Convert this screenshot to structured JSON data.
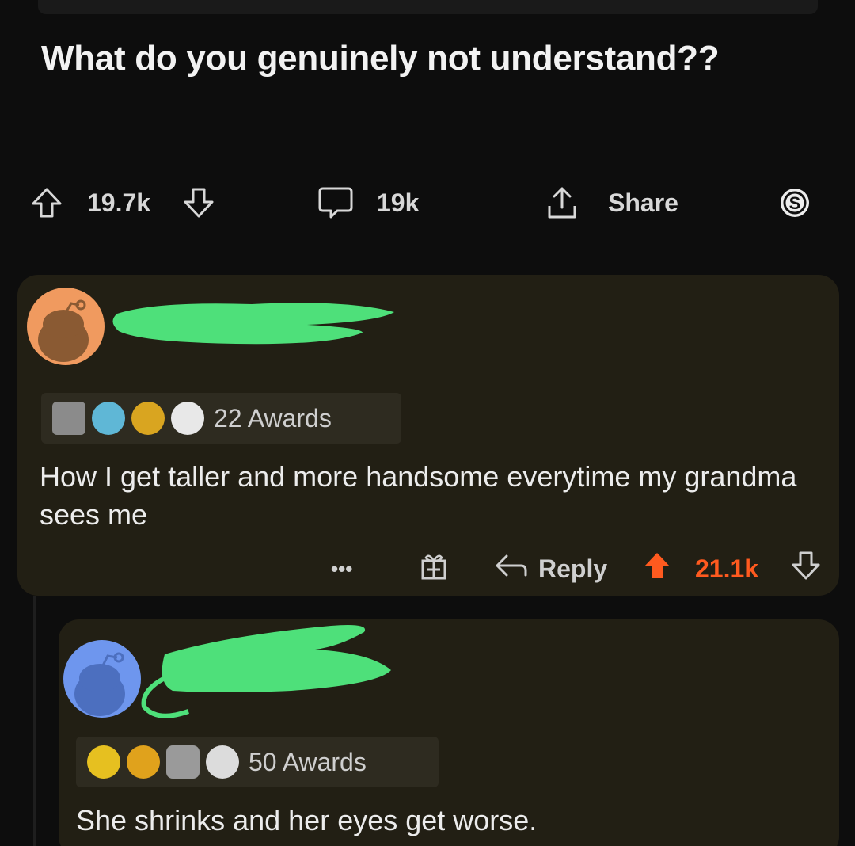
{
  "post": {
    "title": "What do you genuinely not understand??",
    "upvotes": "19.7k",
    "comments": "19k",
    "share_label": "Share"
  },
  "comments": [
    {
      "avatar_color": "#f09a5f",
      "awards_label": "22 Awards",
      "text": "How I get taller and more handsome everytime my grandma sees me",
      "more_label": "•••",
      "reply_label": "Reply",
      "score": "21.1k",
      "score_color": "#ff5a1f"
    },
    {
      "avatar_color": "#6e96ee",
      "awards_label": "50 Awards",
      "text": "She shrinks and her eyes get worse."
    }
  ],
  "colors": {
    "background": "#0d0d0d",
    "card": "#221f14",
    "redaction": "#4ee07a",
    "upvote_active": "#ff5a1f"
  },
  "icons": [
    "upvote-arrow-icon",
    "downvote-arrow-icon",
    "comment-bubble-icon",
    "share-icon",
    "coin-icon",
    "gift-icon",
    "reply-arrow-icon"
  ]
}
